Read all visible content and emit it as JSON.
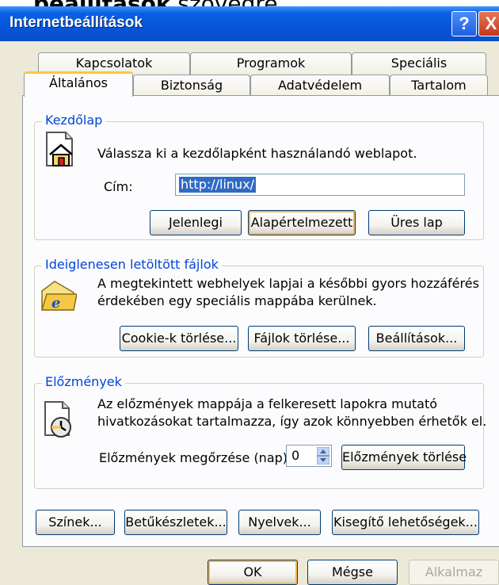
{
  "background_text": {
    "bold": "beállítások",
    "rest": " szövegre."
  },
  "window": {
    "title": "Internetbeállítások",
    "help_label": "?",
    "close_label": "X"
  },
  "tabs_back": [
    "Kapcsolatok",
    "Programok",
    "Speciális"
  ],
  "tabs_front": [
    "Általános",
    "Biztonság",
    "Adatvédelem",
    "Tartalom"
  ],
  "homepage": {
    "group_label": "Kezdőlap",
    "description": "Válassza ki a kezdőlapként használandó weblapot.",
    "address_label": "Cím:",
    "address_value": "http://linux/",
    "buttons": [
      "Jelenlegi",
      "Alapértelmezett",
      "Üres lap"
    ]
  },
  "temp_files": {
    "group_label": "Ideiglenesen letöltött fájlok",
    "description_line1": "A megtekintett webhelyek lapjai a későbbi gyors hozzáférés",
    "description_line2": "érdekében egy speciális mappába kerülnek.",
    "buttons": [
      "Cookie-k törlése...",
      "Fájlok törlése...",
      "Beállítások..."
    ]
  },
  "history": {
    "group_label": "Előzmények",
    "description_line1": "Az előzmények mappája a felkeresett lapokra mutató",
    "description_line2": "hivatkozásokat tartalmazza, így azok könnyebben érhetők el.",
    "days_label": "Előzmények megőrzése (nap):",
    "days_value": "0",
    "clear_button": "Előzmények törlése"
  },
  "bottom_buttons": [
    "Színek...",
    "Betűkészletek...",
    "Nyelvek...",
    "Kisegítő lehetőségek..."
  ],
  "dialog_buttons": {
    "ok": "OK",
    "cancel": "Mégse",
    "apply": "Alkalmaz"
  }
}
